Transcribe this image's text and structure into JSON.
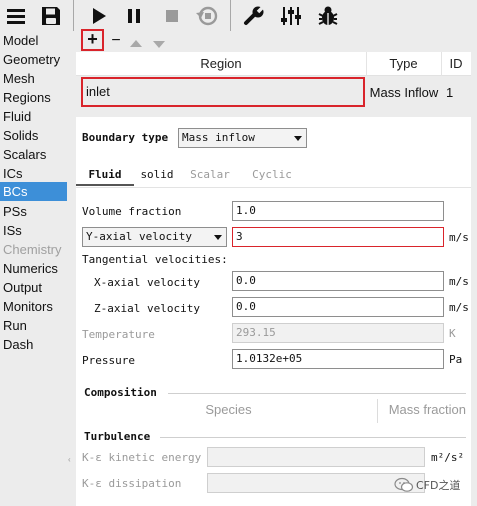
{
  "toolbar": {
    "icons": [
      "menu-icon",
      "save-icon",
      "play-icon",
      "pause-icon",
      "stop-icon",
      "restore-icon",
      "wrench-icon",
      "sliders-icon",
      "bug-icon"
    ]
  },
  "sidebar": {
    "items": [
      {
        "label": "Model",
        "state": "normal"
      },
      {
        "label": "Geometry",
        "state": "normal"
      },
      {
        "label": "Mesh",
        "state": "normal"
      },
      {
        "label": "Regions",
        "state": "normal"
      },
      {
        "label": "Fluid",
        "state": "normal"
      },
      {
        "label": "Solids",
        "state": "normal"
      },
      {
        "label": "Scalars",
        "state": "normal"
      },
      {
        "label": "ICs",
        "state": "normal"
      },
      {
        "label": "BCs",
        "state": "active"
      },
      {
        "label": "PSs",
        "state": "normal"
      },
      {
        "label": "ISs",
        "state": "normal"
      },
      {
        "label": "Chemistry",
        "state": "disabled"
      },
      {
        "label": "Numerics",
        "state": "normal"
      },
      {
        "label": "Output",
        "state": "normal"
      },
      {
        "label": "Monitors",
        "state": "normal"
      },
      {
        "label": "Run",
        "state": "normal"
      },
      {
        "label": "Dash",
        "state": "normal"
      }
    ]
  },
  "region_table": {
    "add_label": "+",
    "remove_label": "−",
    "columns": [
      "Region",
      "Type",
      "ID"
    ],
    "rows": [
      {
        "region": "inlet",
        "type": "Mass Inflow",
        "id": "1"
      }
    ]
  },
  "form": {
    "boundary_type_label": "Boundary type",
    "boundary_type_value": "Mass inflow",
    "tabs": [
      "Fluid",
      "solid",
      "Scalar",
      "Cyclic"
    ],
    "active_tab": "Fluid",
    "volume_fraction_label": "Volume fraction",
    "volume_fraction_value": "1.0",
    "velocity_selector": "Y-axial velocity",
    "velocity_value": "3",
    "velocity_unit": "m/s",
    "tangential_label": "Tangential velocities:",
    "x_velocity_label": "X-axial velocity",
    "x_velocity_value": "0.0",
    "x_velocity_unit": "m/s",
    "z_velocity_label": "Z-axial velocity",
    "z_velocity_value": "0.0",
    "z_velocity_unit": "m/s",
    "temperature_label": "Temperature",
    "temperature_value": "293.15",
    "temperature_unit": "K",
    "pressure_label": "Pressure",
    "pressure_value": "1.0132e+05",
    "pressure_unit": "Pa",
    "composition_label": "Composition",
    "species_header": "Species",
    "mass_fraction_header": "Mass fraction",
    "turbulence_label": "Turbulence",
    "k_label": "K-ε kinetic energy",
    "k_unit": "m²/s²",
    "eps_label": "K-ε dissipation"
  },
  "watermark": "CFD之道",
  "colors": {
    "active_sidebar": "#3d8fd8",
    "highlight_border": "#d9242b"
  }
}
